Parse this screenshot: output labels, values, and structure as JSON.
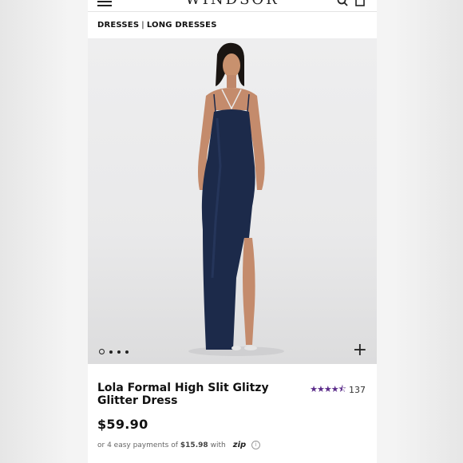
{
  "header": {
    "logo": "WINDSOR",
    "menu_icon": "hamburger-menu-icon",
    "search_icon": "search-icon",
    "bag_icon": "shopping-bag-icon"
  },
  "breadcrumb": {
    "items": [
      "DRESSES",
      "LONG DRESSES"
    ],
    "separator": "|"
  },
  "gallery": {
    "image_alt": "Model wearing navy glitter high slit maxi dress",
    "current_image": 1,
    "total_images": 4,
    "expand_icon": "plus-icon"
  },
  "product": {
    "title": "Lola Formal High Slit Glitzy Glitter Dress",
    "rating": 4.5,
    "rating_stars": "★★★★⯪",
    "review_count": "137",
    "price": "$59.90"
  },
  "payment": {
    "prefix": "or 4 easy payments of",
    "amount": "$15.98",
    "suffix": "with",
    "provider": "zip",
    "info_icon": "info-icon"
  },
  "colors": {
    "star": "#5b2c8a",
    "dress": "#1c2a4a"
  }
}
